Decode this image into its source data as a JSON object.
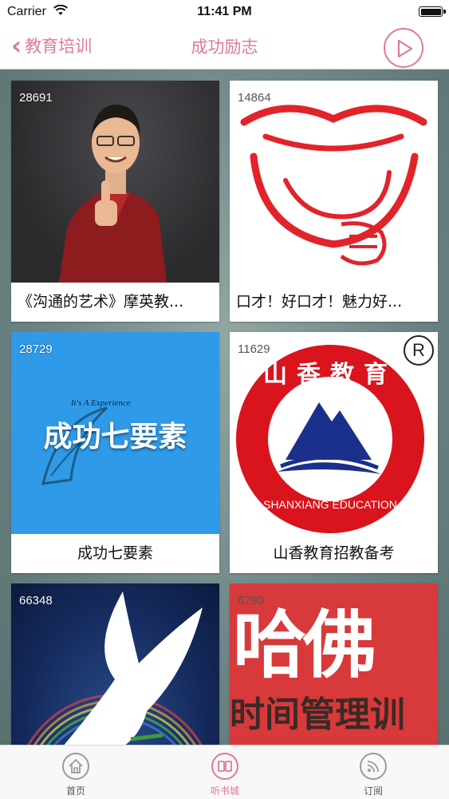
{
  "status": {
    "carrier": "Carrier",
    "time": "11:41 PM",
    "battery_level": 1.0
  },
  "nav": {
    "back_label": "教育培训",
    "title": "成功励志",
    "play_icon": "play-circle-icon",
    "accent": "#e07a95"
  },
  "cards": [
    {
      "count": "28691",
      "title": "《沟通的艺术》摩英教..."
    },
    {
      "count": "14864",
      "title": "口才！好口才！魅力好..."
    },
    {
      "count": "28729",
      "title": "成功七要素",
      "cover_text": "成功七要素",
      "cover_subtext": "It's A Experience"
    },
    {
      "count": "11629",
      "title": "山香教育招教备考",
      "cover_top": "山香教育",
      "cover_bottom": "SHANXIANG EDUCATION",
      "registered": "R"
    },
    {
      "count": "66348",
      "title": ""
    },
    {
      "count": "6793",
      "title": "",
      "cover_big": "哈佛",
      "cover_small": "时间管理训"
    }
  ],
  "tabs": [
    {
      "label": "首页",
      "icon": "home-icon",
      "active": false
    },
    {
      "label": "听书城",
      "icon": "book-icon",
      "active": true
    },
    {
      "label": "订阅",
      "icon": "rss-icon",
      "active": false
    }
  ]
}
